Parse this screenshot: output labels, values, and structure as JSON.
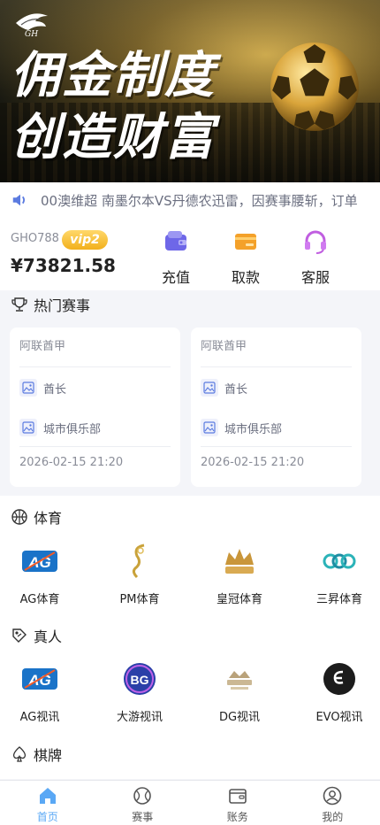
{
  "banner": {
    "logo_text": "GH",
    "headline_1": "佣金制度",
    "headline_2": "创造财富"
  },
  "marquee": {
    "text": "00澳维超 南墨尔本VS丹德农迅雷，因赛事腰斩，订单"
  },
  "user": {
    "account": "GHO788",
    "vip": "vip2",
    "balance": "¥73821.58",
    "actions": [
      {
        "label": "充值",
        "icon": "wallet-icon"
      },
      {
        "label": "取款",
        "icon": "card-icon"
      },
      {
        "label": "客服",
        "icon": "headset-icon"
      }
    ]
  },
  "hot": {
    "title": "热门赛事",
    "matches": [
      {
        "league": "阿联酋甲",
        "home": "酋长",
        "away": "城市俱乐部",
        "time": "2026-02-15 21:20"
      },
      {
        "league": "阿联酋甲",
        "home": "酋长",
        "away": "城市俱乐部",
        "time": "2026-02-15 21:20"
      }
    ]
  },
  "sports": {
    "title": "体育",
    "items": [
      {
        "name": "AG体育",
        "icon": "ag-logo-icon"
      },
      {
        "name": "PM体育",
        "icon": "pm-logo-icon"
      },
      {
        "name": "皇冠体育",
        "icon": "crown-logo-icon"
      },
      {
        "name": "三昇体育",
        "icon": "sansheng-logo-icon"
      }
    ]
  },
  "live": {
    "title": "真人",
    "items": [
      {
        "name": "AG视讯",
        "icon": "ag-logo-icon"
      },
      {
        "name": "大游视讯",
        "icon": "bg-logo-icon"
      },
      {
        "name": "DG视讯",
        "icon": "dg-logo-icon"
      },
      {
        "name": "EVO视讯",
        "icon": "evo-logo-icon"
      }
    ]
  },
  "cards": {
    "title": "棋牌"
  },
  "tabbar": {
    "active_color": "#5aa8f5",
    "items": [
      {
        "label": "首页",
        "icon": "home-icon"
      },
      {
        "label": "赛事",
        "icon": "ball-icon"
      },
      {
        "label": "账务",
        "icon": "wallet-icon"
      },
      {
        "label": "我的",
        "icon": "user-icon"
      }
    ]
  }
}
